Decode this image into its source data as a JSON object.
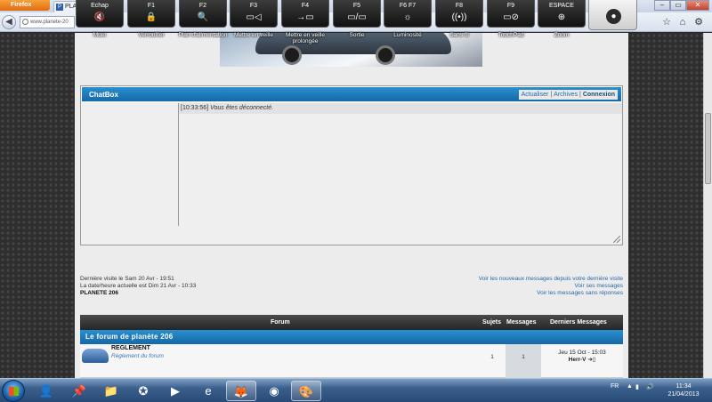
{
  "browser": {
    "menu_button": "Firefox",
    "tab_title": "PLA",
    "url": "www.planete-20",
    "window_controls": [
      "–",
      "▭",
      "✕"
    ]
  },
  "osd": {
    "keys": [
      {
        "key": "Echap",
        "icon": "🔇",
        "caption": "Muet"
      },
      {
        "key": "F1",
        "icon": "🔒",
        "caption": "Verrouiller"
      },
      {
        "key": "F2",
        "icon": "🔍",
        "caption": "Plan d'alimentation"
      },
      {
        "key": "F3",
        "icon": "▭◁",
        "caption": "Mettre en veille"
      },
      {
        "key": "F4",
        "icon": "→▭",
        "caption": "Mettre en veille prolongée"
      },
      {
        "key": "F5",
        "icon": "▭/▭",
        "caption": "Sortie"
      },
      {
        "key": "F6       F7",
        "icon": "☼",
        "caption": "Luminosité"
      },
      {
        "key": "F8",
        "icon": "((•))",
        "caption": "Sans fil"
      },
      {
        "key": "F9",
        "icon": "▭⊘",
        "caption": "TouchPad"
      },
      {
        "key": "ESPACE",
        "icon": "⊕",
        "caption": "Zoom"
      }
    ]
  },
  "chatbox": {
    "title": "ChatBox",
    "links": [
      "Actualiser",
      "Archives",
      "Connexion"
    ],
    "message_time": "[10:33:56]",
    "message_text": "Vous êtes déconnecté."
  },
  "info": {
    "last_visit": "Dernière visite le Sam 20 Avr - 19:51",
    "current_time": "La date/heure actuelle est Dim 21 Avr - 10:33",
    "site_name": "PLANETE 206",
    "links": [
      "Voir les nouveaux messages depuis votre dernière visite",
      "Voir ses messages",
      "Voir les messages sans réponses"
    ]
  },
  "forum": {
    "headers": {
      "forum": "Forum",
      "topics": "Sujets",
      "messages": "Messages",
      "last": "Derniers Messages"
    },
    "category": "Le forum de planète 206",
    "rows": [
      {
        "name": "REGLEMENT",
        "desc": "Règlement du forum",
        "topics": "1",
        "messages": "1",
        "last_date": "Jeu 15 Oct - 15:03",
        "last_user": "Herr-V"
      }
    ]
  },
  "taskbar": {
    "language": "FR",
    "time": "11:34",
    "date": "21/04/2013"
  }
}
